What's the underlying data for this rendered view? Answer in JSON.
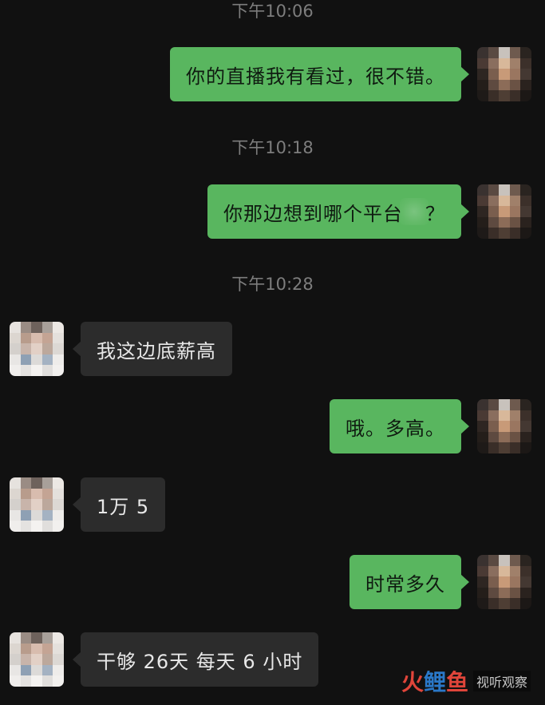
{
  "chat": {
    "messages": [
      {
        "type": "time",
        "text": "下午10:06"
      },
      {
        "type": "out",
        "text": "你的直播我有看过，很不错。"
      },
      {
        "type": "time",
        "text": "下午10:18"
      },
      {
        "type": "out",
        "text_a": "你那边想到哪个平台",
        "text_b": "？"
      },
      {
        "type": "time",
        "text": "下午10:28"
      },
      {
        "type": "in",
        "text": "我这边底薪高"
      },
      {
        "type": "out",
        "text": "哦。多高。"
      },
      {
        "type": "in",
        "text": "1万 5"
      },
      {
        "type": "out",
        "text": "时常多久"
      },
      {
        "type": "in",
        "text": "干够 26天 每天 6 小时"
      }
    ]
  },
  "watermark": {
    "logo_a": "火",
    "logo_b": "鲤",
    "logo_c": "鱼",
    "text": "视听观察"
  },
  "colors": {
    "background": "#111111",
    "outgoing_bubble": "#59b65f",
    "incoming_bubble": "#2c2c2c",
    "timestamp": "#7d7d7d"
  }
}
